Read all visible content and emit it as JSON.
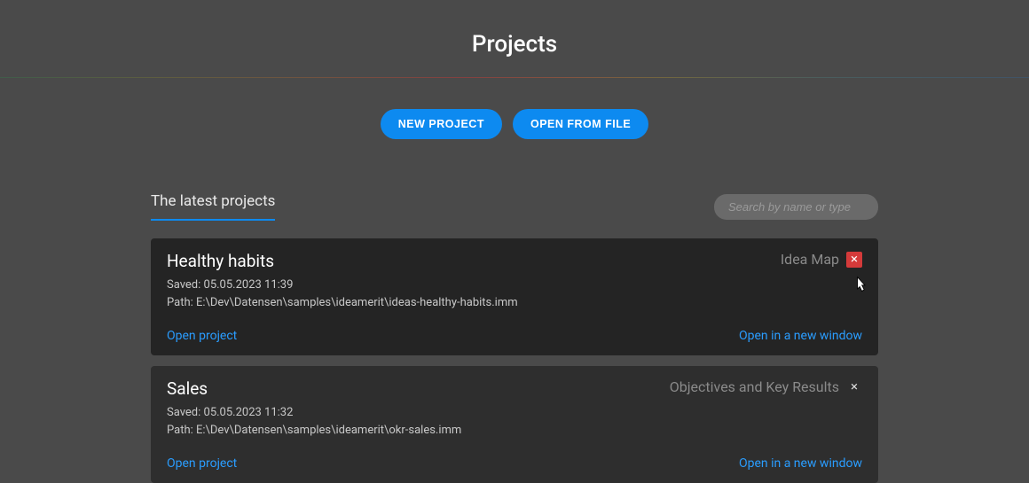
{
  "header": {
    "title": "Projects"
  },
  "actions": {
    "new_project": "NEW PROJECT",
    "open_from_file": "OPEN FROM FILE"
  },
  "section": {
    "title": "The latest projects",
    "search_placeholder": "Search by name or type"
  },
  "projects": [
    {
      "name": "Healthy habits",
      "type": "Idea Map",
      "saved_line": "Saved: 05.05.2023 11:39",
      "path_line": "Path: E:\\Dev\\Datensen\\samples\\ideamerit\\ideas-healthy-habits.imm",
      "open_label": "Open project",
      "open_new_label": "Open in a new window",
      "close_hovered": true
    },
    {
      "name": "Sales",
      "type": "Objectives and Key Results",
      "saved_line": "Saved: 05.05.2023 11:32",
      "path_line": "Path: E:\\Dev\\Datensen\\samples\\ideamerit\\okr-sales.imm",
      "open_label": "Open project",
      "open_new_label": "Open in a new window",
      "close_hovered": false
    }
  ]
}
